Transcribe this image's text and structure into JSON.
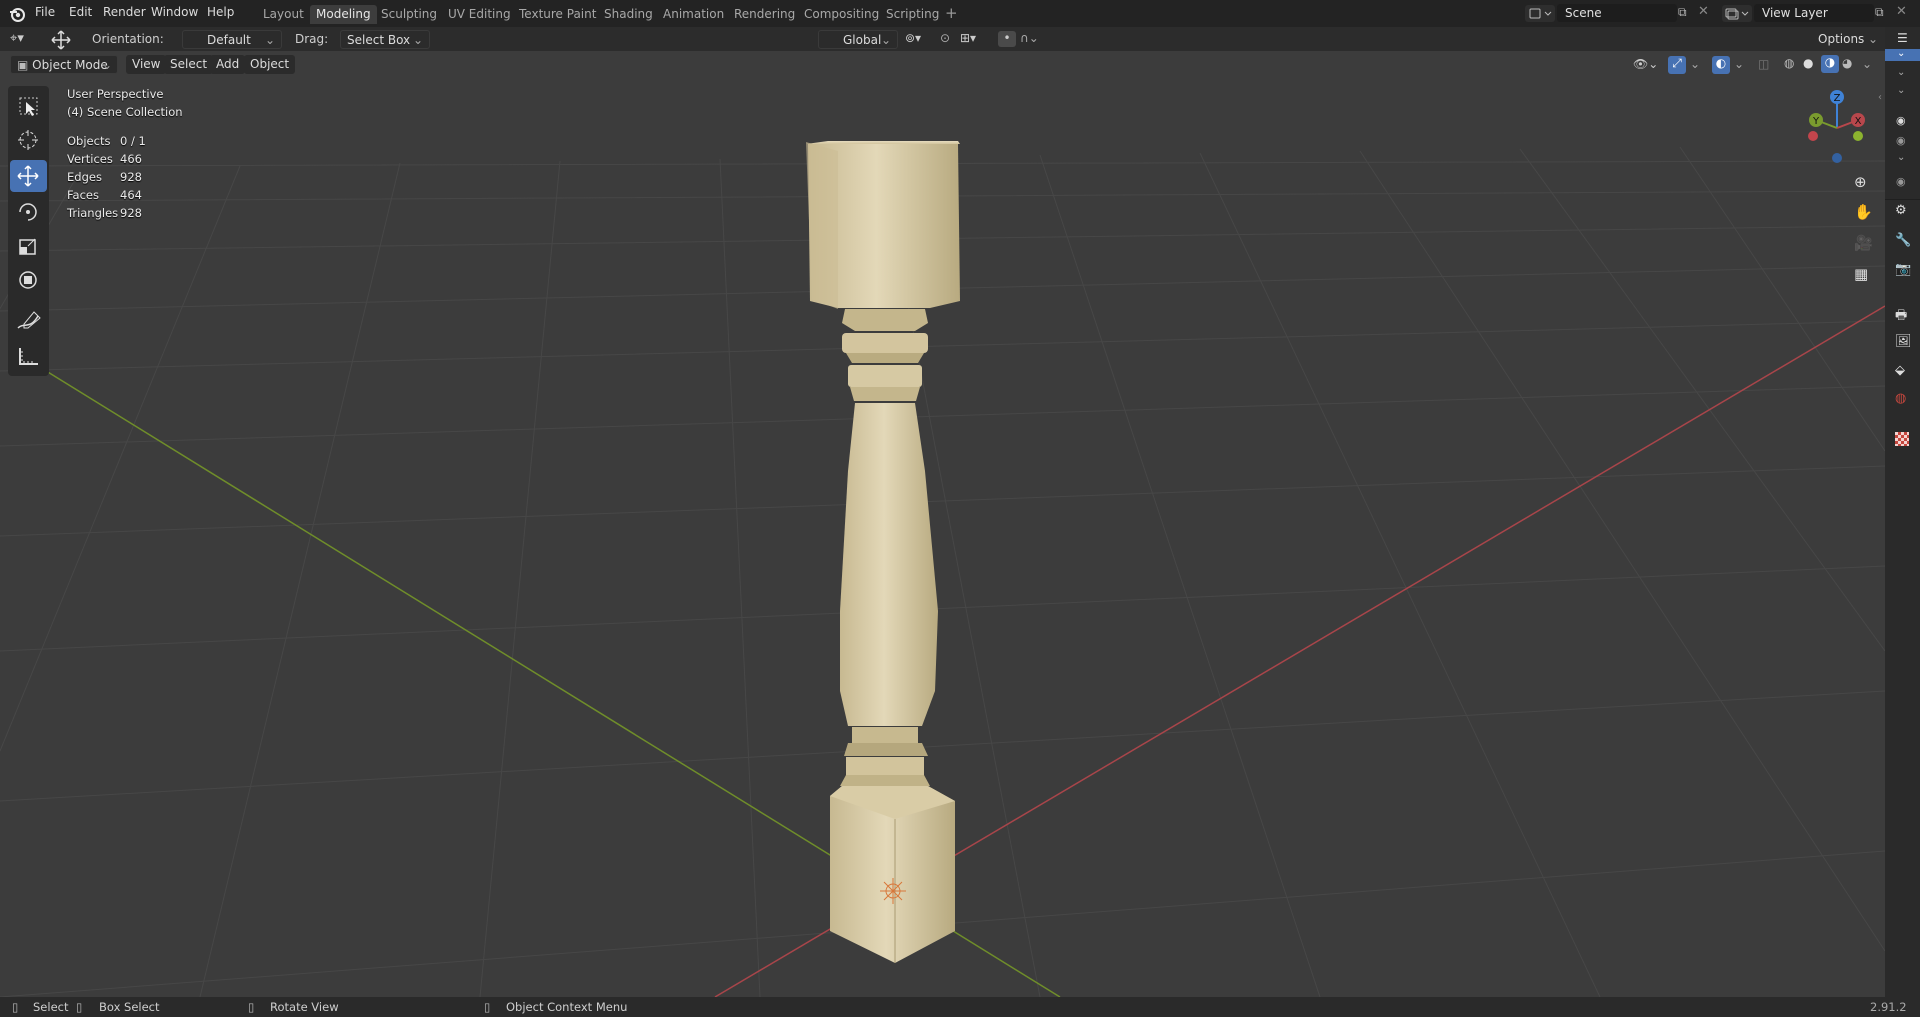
{
  "menu": [
    "File",
    "Edit",
    "Render",
    "Window",
    "Help"
  ],
  "workspaces": [
    "Layout",
    "Modeling",
    "Sculpting",
    "UV Editing",
    "Texture Paint",
    "Shading",
    "Animation",
    "Rendering",
    "Compositing",
    "Scripting"
  ],
  "active_workspace": "Modeling",
  "scene_name": "Scene",
  "view_layer_name": "View Layer",
  "tool_header": {
    "orientation_label": "Orientation:",
    "orientation_value": "Default",
    "drag_label": "Drag:",
    "drag_value": "Select Box",
    "transform_orientation": "Global",
    "options_label": "Options"
  },
  "viewport_header": {
    "mode": "Object Mode",
    "view": "View",
    "select": "Select",
    "add": "Add",
    "object": "Object"
  },
  "overlay": {
    "perspective": "User Perspective",
    "collection": "(4) Scene Collection",
    "stats": [
      {
        "label": "Objects",
        "value": "0 / 1"
      },
      {
        "label": "Vertices",
        "value": "466"
      },
      {
        "label": "Edges",
        "value": "928"
      },
      {
        "label": "Faces",
        "value": "464"
      },
      {
        "label": "Triangles",
        "value": "928"
      }
    ]
  },
  "gizmo": {
    "x": "X",
    "y": "Y",
    "z": "Z"
  },
  "status_bar": {
    "select": "Select",
    "box_select": "Box Select",
    "rotate_view": "Rotate View",
    "context_menu": "Object Context Menu",
    "version": "2.91.2"
  },
  "colors": {
    "accent": "#4772b3",
    "x_axis": "#b8474c",
    "y_axis": "#7a9b2e",
    "z_axis": "#3f82d6",
    "object": "#d9ccaa"
  }
}
